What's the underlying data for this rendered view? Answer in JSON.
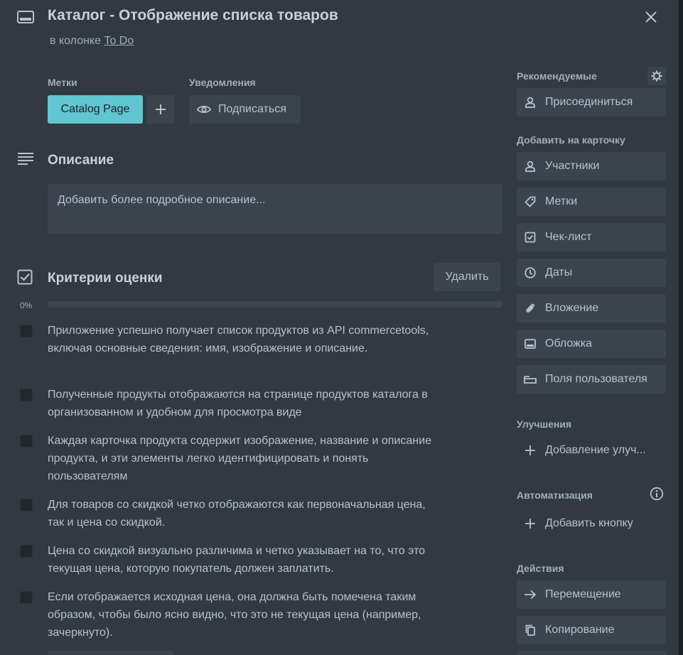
{
  "header": {
    "title": "Каталог - Отображение списка товаров",
    "in_column_prefix": "в колонке",
    "column_name": "To Do"
  },
  "labels_section": {
    "labels_title": "Метки",
    "label_chip": "Catalog Page",
    "label_chip_color": "#60c6d2",
    "notifications_title": "Уведомления",
    "watch_label": "Подписаться"
  },
  "description": {
    "title": "Описание",
    "placeholder": "Добавить более подробное описание..."
  },
  "checklist": {
    "title": "Критерии оценки",
    "delete_label": "Удалить",
    "progress_text": "0%",
    "progress_value": 0,
    "items": [
      {
        "text": "Приложение успешно получает список продуктов из API commercetools, включая основные сведения: имя, изображение и описание.",
        "checked": false
      },
      {
        "text": "Полученные продукты отображаются на странице продуктов каталога в организованном и удобном для просмотра виде",
        "checked": false
      },
      {
        "text": "Каждая карточка продукта содержит изображение, название и описание продукта, и эти элементы легко идентифицировать и понять пользователям",
        "checked": false
      },
      {
        "text": "Для товаров со скидкой четко отображаются как первоначальная цена, так и цена со скидкой.",
        "checked": false
      },
      {
        "text": "Цена со скидкой визуально различима и четко указывает на то, что это текущая цена, которую покупатель должен заплатить.",
        "checked": false
      },
      {
        "text": "Если отображается исходная цена, она должна быть помечена таким образом, чтобы было ясно видно, что это не текущая цена (например, зачеркнуто).",
        "checked": false
      }
    ]
  },
  "sidebar": {
    "suggested_title": "Рекомендуемые",
    "join_label": "Присоединиться",
    "add_to_card_title": "Добавить на карточку",
    "add_buttons": [
      {
        "label": "Участники",
        "icon": "person-icon"
      },
      {
        "label": "Метки",
        "icon": "tag-icon"
      },
      {
        "label": "Чек-лист",
        "icon": "checklist-icon"
      },
      {
        "label": "Даты",
        "icon": "clock-icon"
      },
      {
        "label": "Вложение",
        "icon": "paperclip-icon"
      },
      {
        "label": "Обложка",
        "icon": "cover-icon"
      },
      {
        "label": "Поля пользователя",
        "icon": "custom-fields-icon"
      }
    ],
    "powerups_title": "Улучшения",
    "add_powerup_label": "Добавление улуч...",
    "automation_title": "Автоматизация",
    "add_button_label": "Добавить кнопку",
    "actions_title": "Действия",
    "action_buttons": [
      {
        "label": "Перемещение",
        "icon": "arrow-right-icon"
      },
      {
        "label": "Копирование",
        "icon": "copy-icon"
      }
    ]
  }
}
